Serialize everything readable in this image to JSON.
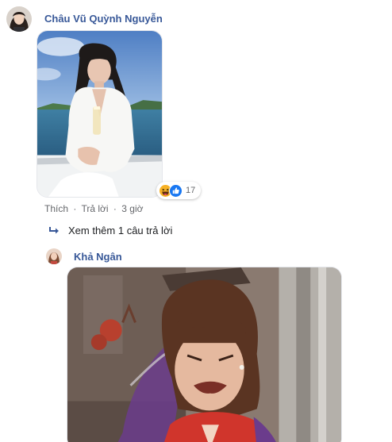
{
  "comment1": {
    "author": "Châu Vũ Quỳnh Nguyễn",
    "reactions": {
      "icons": [
        "haha-icon",
        "like-icon"
      ],
      "count": "17"
    },
    "actions": {
      "like": "Thích",
      "reply": "Trả lời",
      "time": "3 giờ",
      "separator": "·"
    }
  },
  "more_replies": {
    "label": "Xem thêm 1 câu trả lời"
  },
  "comment2": {
    "author": "Khả Ngân"
  },
  "colors": {
    "name_link": "#385898",
    "muted": "#65676b",
    "like_blue": "#1877f2",
    "haha_yellow": "#f7b125"
  }
}
